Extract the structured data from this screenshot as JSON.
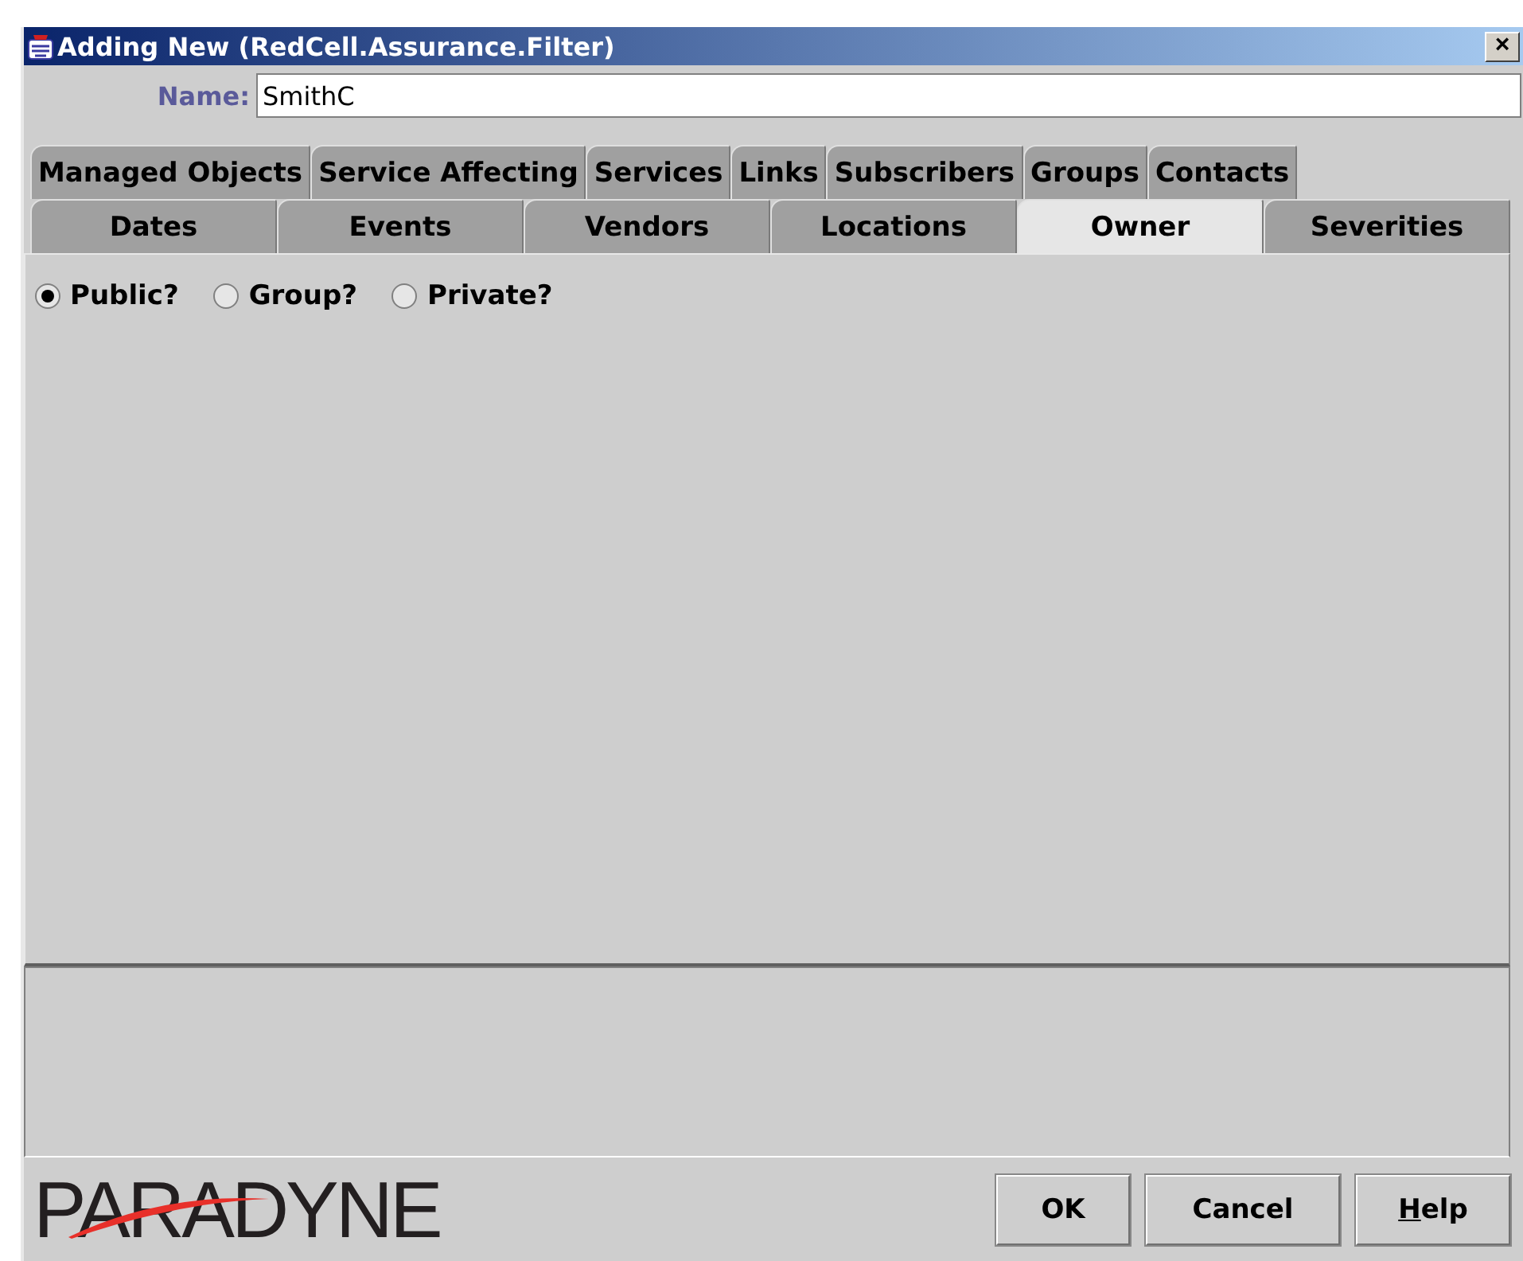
{
  "window": {
    "title": "Adding New (RedCell.Assurance.Filter)",
    "close_glyph": "×"
  },
  "name_field": {
    "label": "Name:",
    "value": "SmithC"
  },
  "tab_rows": [
    {
      "tabs": [
        {
          "label": "Managed Objects",
          "selected": false
        },
        {
          "label": "Service Affecting",
          "selected": false
        },
        {
          "label": "Services",
          "selected": false
        },
        {
          "label": "Links",
          "selected": false
        },
        {
          "label": "Subscribers",
          "selected": false
        },
        {
          "label": "Groups",
          "selected": false
        },
        {
          "label": "Contacts",
          "selected": false
        }
      ]
    },
    {
      "tabs": [
        {
          "label": "Dates",
          "selected": false
        },
        {
          "label": "Events",
          "selected": false
        },
        {
          "label": "Vendors",
          "selected": false
        },
        {
          "label": "Locations",
          "selected": false
        },
        {
          "label": "Owner",
          "selected": true
        },
        {
          "label": "Severities",
          "selected": false
        }
      ]
    }
  ],
  "owner_options": [
    {
      "label": "Public?",
      "selected": true
    },
    {
      "label": "Group?",
      "selected": false
    },
    {
      "label": "Private?",
      "selected": false
    }
  ],
  "logo": {
    "text": "PARADYNE"
  },
  "buttons": [
    {
      "label": "OK",
      "mnemonic_first": false
    },
    {
      "label": "Cancel",
      "mnemonic_first": false
    },
    {
      "label": "Help",
      "mnemonic_first": true
    }
  ]
}
